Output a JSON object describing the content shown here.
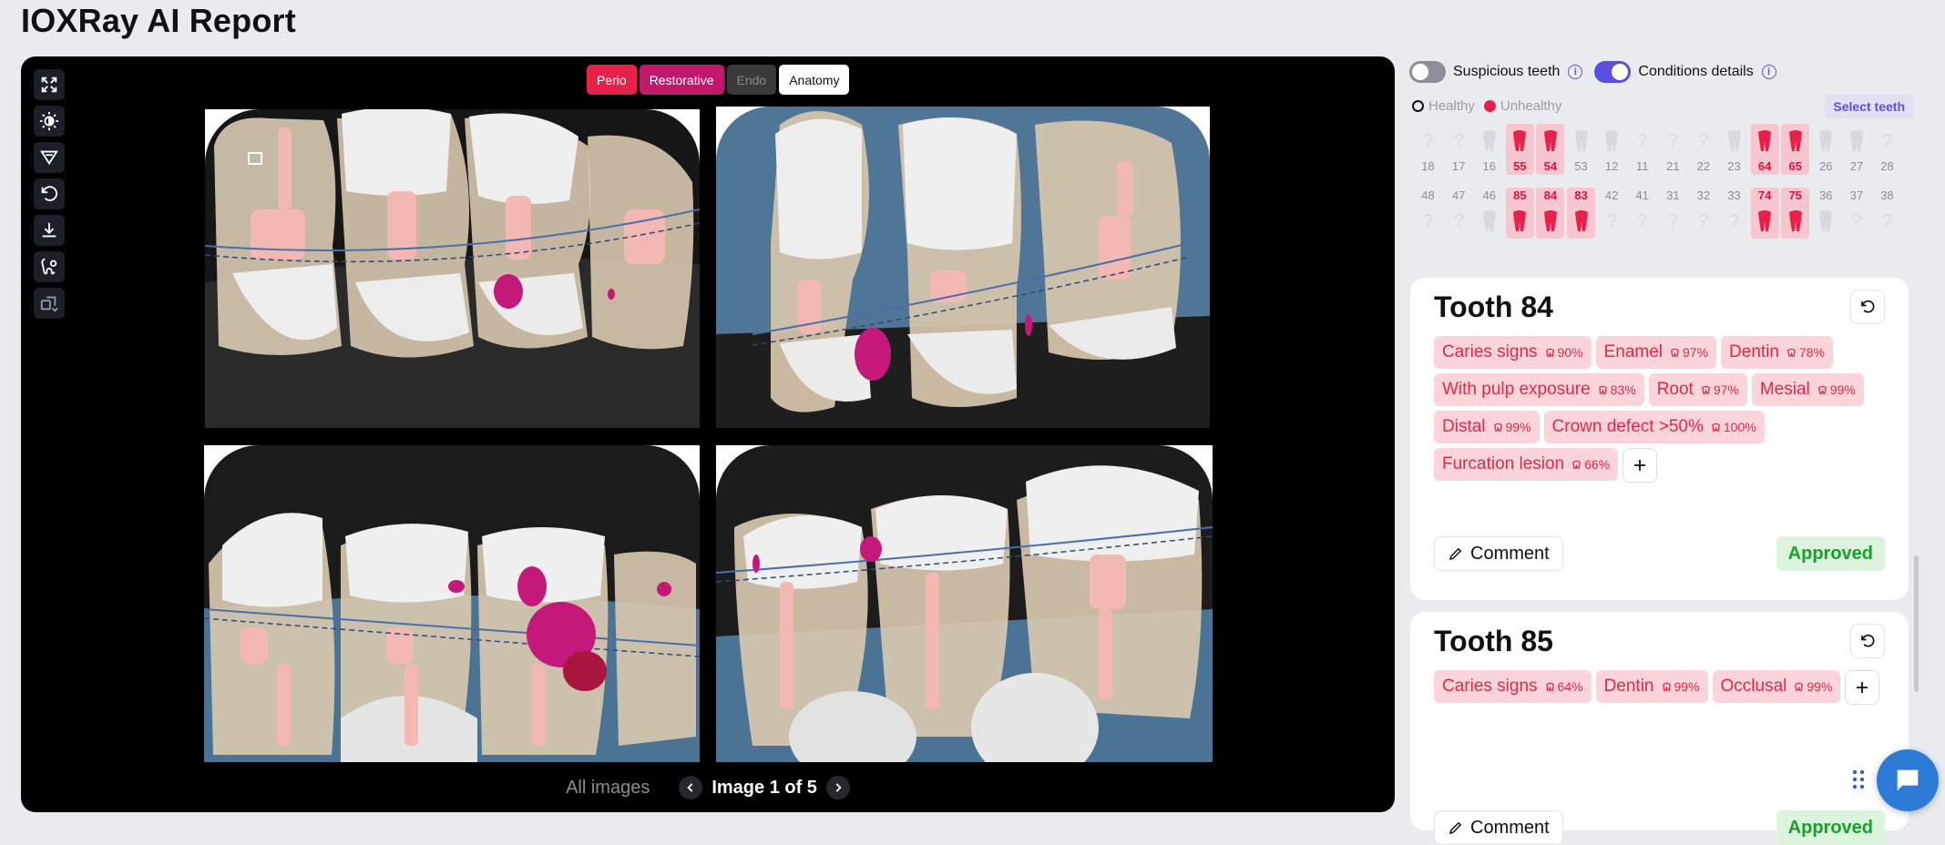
{
  "page": {
    "title": "IOXRay AI Report"
  },
  "viewer": {
    "filters": [
      {
        "label": "Perio",
        "state": "active"
      },
      {
        "label": "Restorative",
        "state": "active"
      },
      {
        "label": "Endo",
        "state": "disabled"
      },
      {
        "label": "Anatomy",
        "state": "selected"
      }
    ],
    "tools": [
      "fullscreen-icon",
      "brightness-icon",
      "filter-icon",
      "undo-icon",
      "download-icon",
      "tooth-settings-icon",
      "compare-icon"
    ],
    "pager": {
      "all_images": "All images",
      "label": "Image 1 of 5"
    }
  },
  "panel": {
    "toggles": {
      "suspicious": {
        "label": "Suspicious teeth",
        "on": false
      },
      "conditions": {
        "label": "Conditions details",
        "on": true
      }
    },
    "legend": {
      "healthy": "Healthy",
      "unhealthy": "Unhealthy"
    },
    "select_teeth": "Select teeth",
    "upper_numbers": [
      "18",
      "17",
      "16",
      "55",
      "54",
      "53",
      "12",
      "11",
      "21",
      "22",
      "23",
      "64",
      "65",
      "26",
      "27",
      "28"
    ],
    "lower_numbers": [
      "48",
      "47",
      "46",
      "85",
      "84",
      "83",
      "42",
      "41",
      "31",
      "32",
      "33",
      "74",
      "75",
      "36",
      "37",
      "38"
    ],
    "highlighted_upper": [
      "55",
      "54",
      "64",
      "65"
    ],
    "highlighted_lower": [
      "85",
      "84",
      "83",
      "74",
      "75"
    ],
    "colors": {
      "unhealthy": "#e8214b",
      "accent": "#5b4fe0",
      "approved": "#18a02c"
    }
  },
  "cards": [
    {
      "title": "Tooth 84",
      "conditions": [
        {
          "name": "Caries signs",
          "pct": "90%"
        },
        {
          "name": "Enamel",
          "pct": "97%"
        },
        {
          "name": "Dentin",
          "pct": "78%"
        },
        {
          "name": "With pulp exposure",
          "pct": "83%"
        },
        {
          "name": "Root",
          "pct": "97%"
        },
        {
          "name": "Mesial",
          "pct": "99%"
        },
        {
          "name": "Distal",
          "pct": "99%"
        },
        {
          "name": "Crown defect >50%",
          "pct": "100%"
        },
        {
          "name": "Furcation lesion",
          "pct": "66%"
        }
      ],
      "comment": "Comment",
      "status": "Approved"
    },
    {
      "title": "Tooth 85",
      "conditions": [
        {
          "name": "Caries signs",
          "pct": "64%"
        },
        {
          "name": "Dentin",
          "pct": "99%"
        },
        {
          "name": "Occlusal",
          "pct": "99%"
        }
      ],
      "comment": "Comment",
      "status": "Approved"
    }
  ]
}
